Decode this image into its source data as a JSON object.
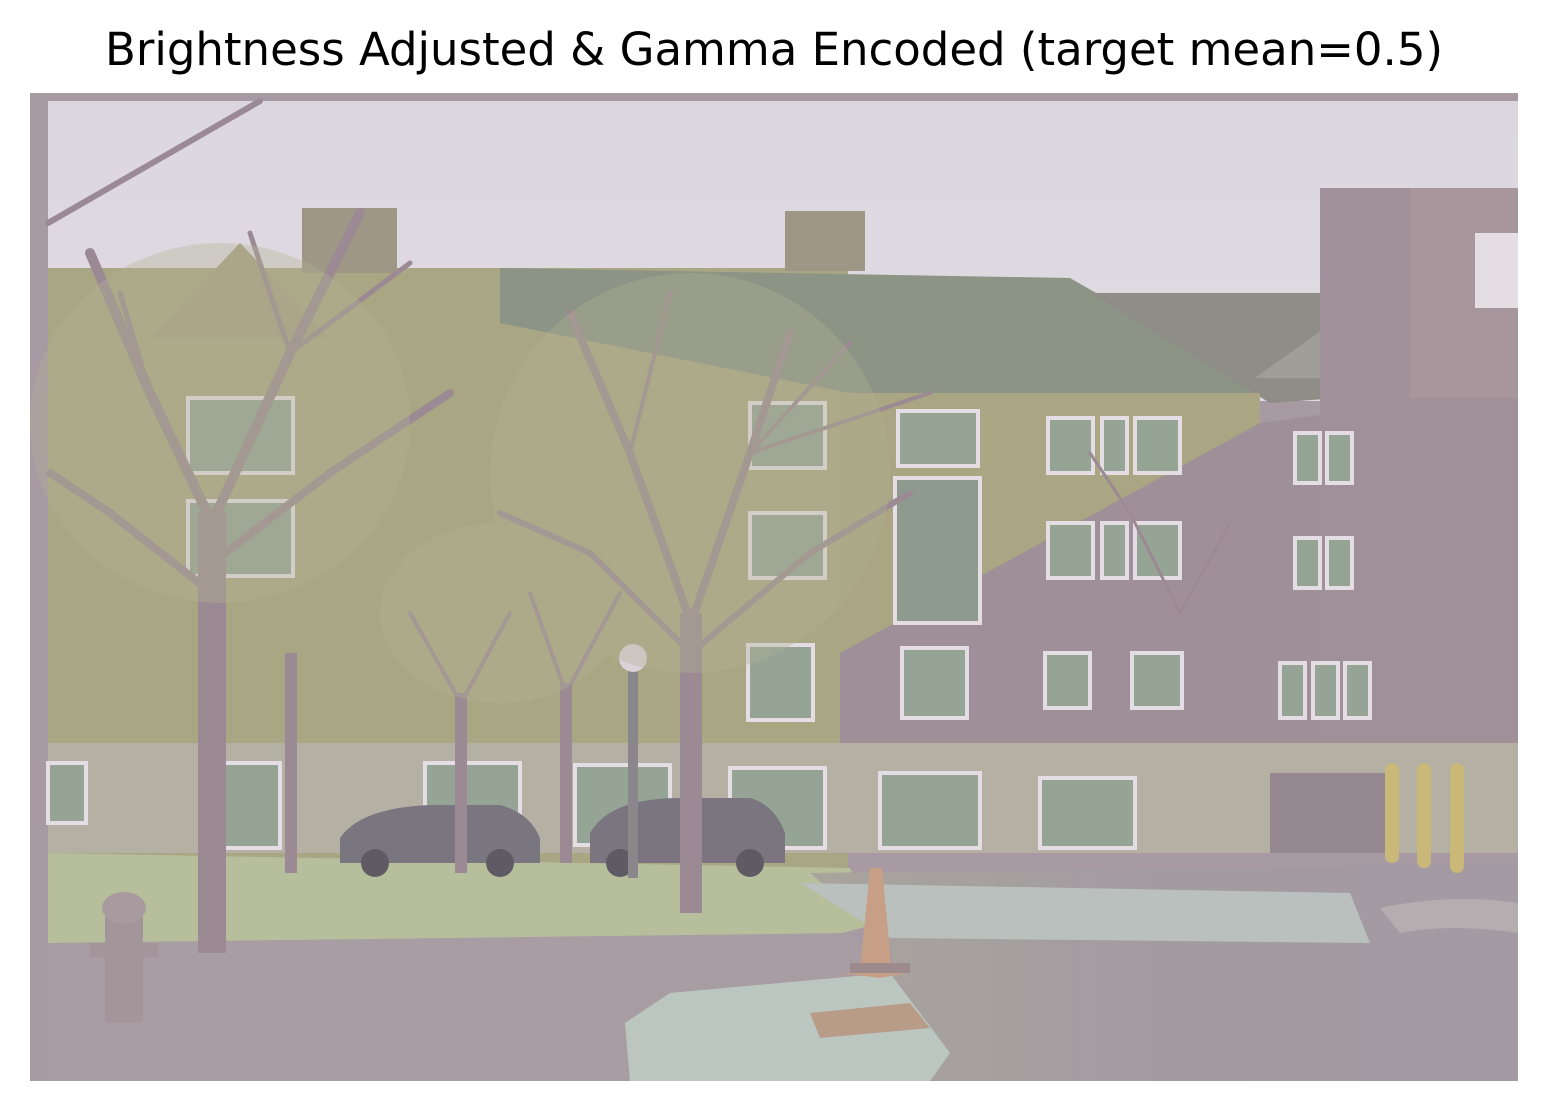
{
  "figure": {
    "title": "Brightness Adjusted & Gamma Encoded (target mean=0.5)"
  },
  "photo": {
    "scene": "campus-building-with-trees",
    "colors": {
      "sky": "#ddd8df",
      "border": "#a89aa3",
      "building_brick_lit": "#a9a684",
      "building_shade": "#9e8f98",
      "roof": "#8c9486",
      "window_frame": "#e4dde4",
      "window_glass": "#95a495",
      "grass": "#b7be9c",
      "road": "#a39aa3",
      "sidewalk": "#bcc6c0",
      "tree_trunk": "#9b8a93",
      "bollard": "#c9b878",
      "cone": "#c79f86"
    }
  }
}
